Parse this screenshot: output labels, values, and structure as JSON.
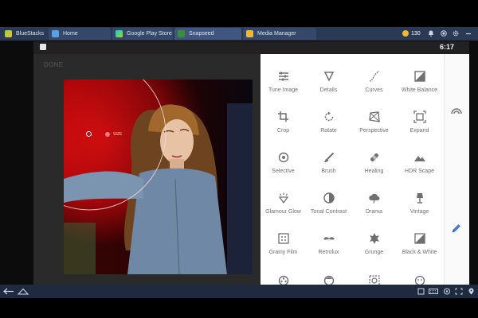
{
  "bluestacks": {
    "brand": "BlueStacks",
    "tabs": [
      {
        "label": "Home"
      },
      {
        "label": "Google Play Store"
      },
      {
        "label": "Snapseed"
      },
      {
        "label": "Media Manager"
      }
    ],
    "coins": "130"
  },
  "status": {
    "time": "6:17"
  },
  "editor": {
    "done_label": "DONE",
    "brush_size_label": "SIZE"
  },
  "tools": [
    {
      "label": "Tune Image",
      "icon": "tune-icon"
    },
    {
      "label": "Details",
      "icon": "details-icon"
    },
    {
      "label": "Curves",
      "icon": "curves-icon"
    },
    {
      "label": "White Balance",
      "icon": "white-balance-icon"
    },
    {
      "label": "Crop",
      "icon": "crop-icon"
    },
    {
      "label": "Rotate",
      "icon": "rotate-icon"
    },
    {
      "label": "Perspective",
      "icon": "perspective-icon"
    },
    {
      "label": "Expand",
      "icon": "expand-icon"
    },
    {
      "label": "Selective",
      "icon": "selective-icon"
    },
    {
      "label": "Brush",
      "icon": "brush-icon"
    },
    {
      "label": "Healing",
      "icon": "healing-icon"
    },
    {
      "label": "HDR Scape",
      "icon": "hdr-scape-icon"
    },
    {
      "label": "Glamour Glow",
      "icon": "glamour-glow-icon"
    },
    {
      "label": "Tonal Contrast",
      "icon": "tonal-contrast-icon"
    },
    {
      "label": "Drama",
      "icon": "drama-icon"
    },
    {
      "label": "Vintage",
      "icon": "vintage-icon"
    },
    {
      "label": "Grainy Film",
      "icon": "grainy-film-icon"
    },
    {
      "label": "Retrolux",
      "icon": "retrolux-icon"
    },
    {
      "label": "Grunge",
      "icon": "grunge-icon"
    },
    {
      "label": "Black & White",
      "icon": "black-white-icon"
    }
  ],
  "colors": {
    "bluestacks_bar": "#2b3a54",
    "active_tab": "#3f5680",
    "panel": "#ffffff",
    "accent_blue": "#4a7bd0"
  }
}
